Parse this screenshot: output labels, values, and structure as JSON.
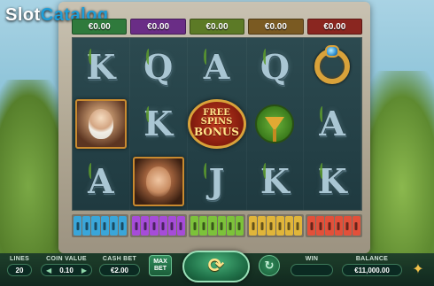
{
  "watermark": {
    "part1": "Slot",
    "part2": "Catalog"
  },
  "logo_fragment": "",
  "win_boxes": [
    {
      "value": "€0.00",
      "color": "#2f7a3c"
    },
    {
      "value": "€0.00",
      "color": "#6a2d86"
    },
    {
      "value": "€0.00",
      "color": "#5c7a26"
    },
    {
      "value": "€0.00",
      "color": "#7a5a22"
    },
    {
      "value": "€0.00",
      "color": "#8a2620"
    }
  ],
  "reels": [
    [
      "K",
      "Q",
      "A",
      "Q",
      "ring"
    ],
    [
      "zeus",
      "K",
      "free_spins_bonus",
      "chalice",
      "A"
    ],
    [
      "A",
      "portrait_woman",
      "J",
      "K",
      "K"
    ]
  ],
  "free_spins": {
    "line1": "FREE",
    "line2": "SPINS",
    "line3": "BONUS"
  },
  "key_groups": [
    {
      "color": "#3aa6d9",
      "count": 6
    },
    {
      "color": "#a64cd8",
      "count": 6
    },
    {
      "color": "#7cc23a",
      "count": 6
    },
    {
      "color": "#e0b53a",
      "count": 6
    },
    {
      "color": "#e2503a",
      "count": 6
    }
  ],
  "controls": {
    "lines": {
      "label": "LINES",
      "value": "20"
    },
    "coin_value": {
      "label": "COIN VALUE",
      "value": "0.10",
      "left_arrow": "◀",
      "right_arrow": "▶"
    },
    "cash_bet": {
      "label": "CASH BET",
      "value": "€2.00"
    },
    "max_bet": {
      "line1": "MAX",
      "line2": "BET"
    },
    "spin_icon": "⟳",
    "autoplay_icon": "↻",
    "win": {
      "label": "WIN",
      "value": ""
    },
    "balance": {
      "label": "BALANCE",
      "value": "€11,000.00"
    },
    "menu_icon": "✦"
  }
}
